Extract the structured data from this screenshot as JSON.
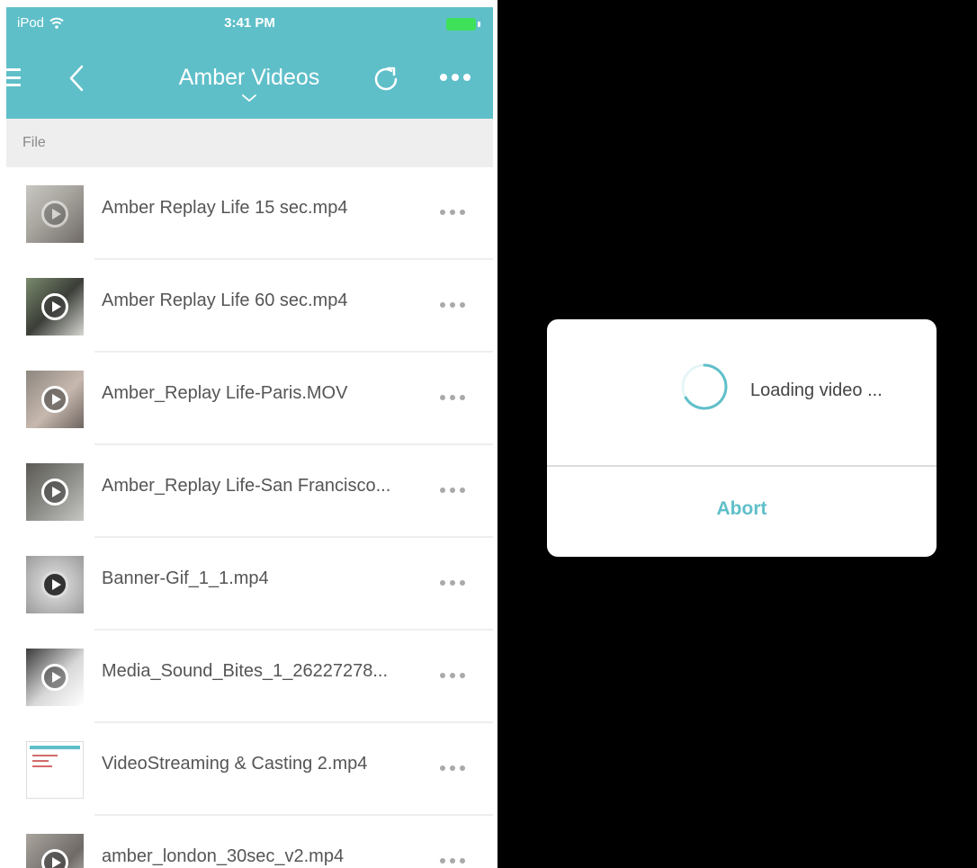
{
  "status_bar": {
    "carrier": "iPod",
    "time": "3:41 PM"
  },
  "nav": {
    "title": "Amber Videos"
  },
  "section": {
    "label": "File"
  },
  "files": [
    {
      "name": "Amber Replay Life 15 sec.mp4"
    },
    {
      "name": "Amber Replay Life 60 sec.mp4"
    },
    {
      "name": "Amber_Replay Life-Paris.MOV"
    },
    {
      "name": "Amber_Replay Life-San Francisco..."
    },
    {
      "name": "Banner-Gif_1_1.mp4"
    },
    {
      "name": "Media_Sound_Bites_1_26227278..."
    },
    {
      "name": "VideoStreaming & Casting 2.mp4"
    },
    {
      "name": "amber_london_30sec_v2.mp4"
    }
  ],
  "dialog": {
    "message": "Loading video ...",
    "abort_label": "Abort"
  },
  "colors": {
    "accent": "#5fbfc9",
    "section_bg": "#eeeeee",
    "battery": "#3fe05a",
    "overlay": "#000000"
  },
  "icons": [
    "menu-icon",
    "back-icon",
    "chevron-down-icon",
    "refresh-icon",
    "more-icon",
    "wifi-icon",
    "battery-icon",
    "play-icon",
    "spinner-icon"
  ]
}
